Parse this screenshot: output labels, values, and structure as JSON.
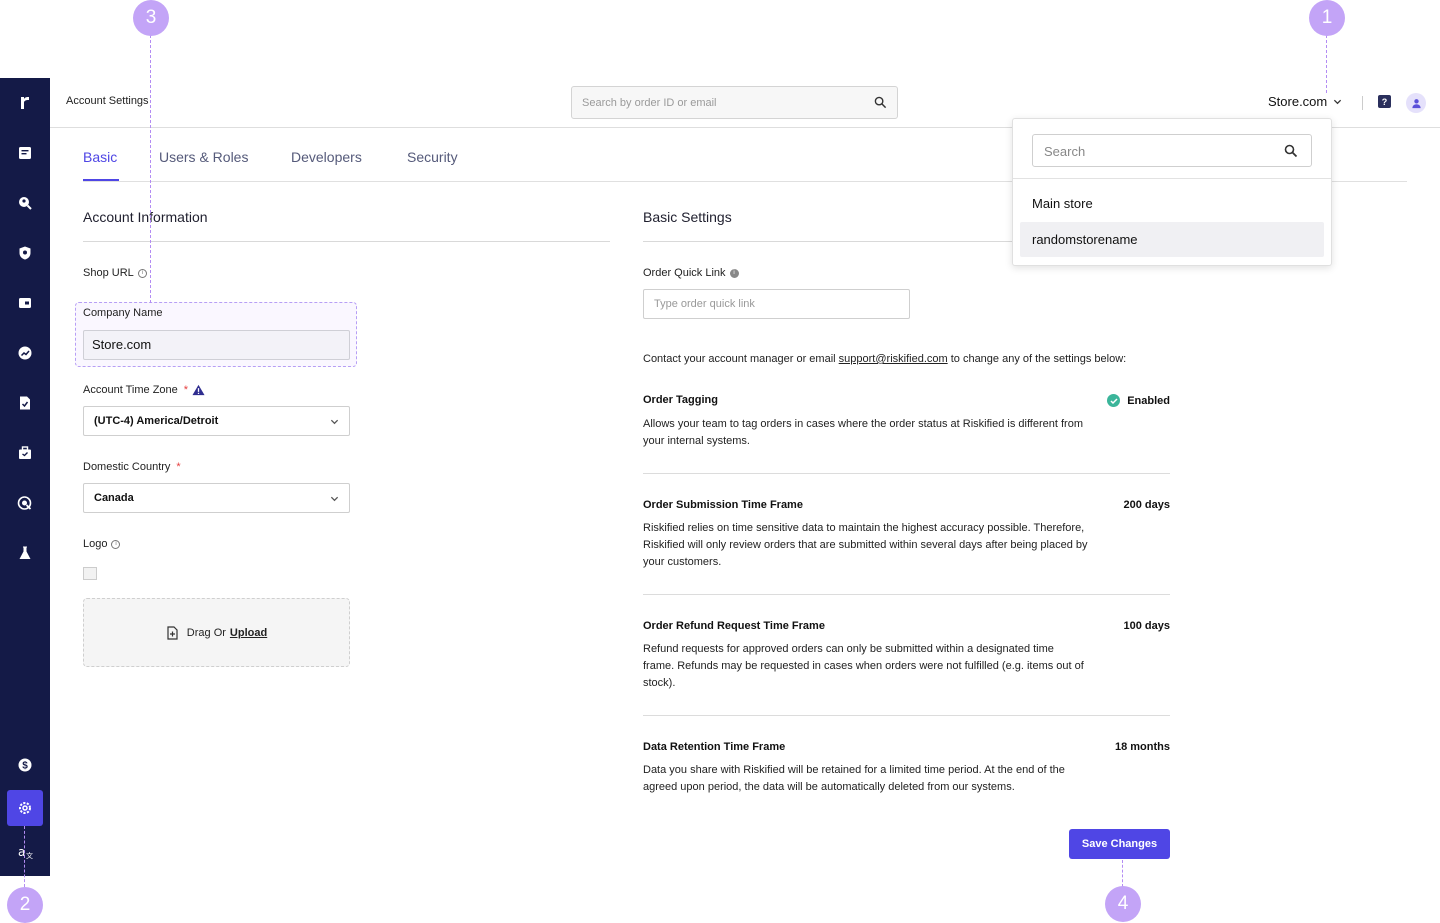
{
  "header": {
    "title": "Account Settings",
    "search_placeholder": "Search by order ID or email",
    "store_selector": "Store.com",
    "help_icon": "?"
  },
  "sidebar": {
    "icons": [
      "logo-icon",
      "orders-icon",
      "investigate-icon",
      "shield-icon",
      "wallet-icon",
      "trend-icon",
      "report-icon",
      "briefcase-icon",
      "radar-icon",
      "flask-icon",
      "dollar-icon",
      "settings-icon",
      "translate-icon"
    ],
    "active": "settings-icon"
  },
  "tabs": [
    {
      "label": "Basic",
      "active": true
    },
    {
      "label": "Users & Roles",
      "active": false
    },
    {
      "label": "Developers",
      "active": false
    },
    {
      "label": "Security",
      "active": false
    }
  ],
  "account_info": {
    "title": "Account Information",
    "shop_url_label": "Shop URL",
    "company_name_label": "Company Name",
    "company_name_value": "Store.com",
    "timezone_label": "Account Time Zone",
    "timezone_required": "*",
    "timezone_value": "(UTC-4) America/Detroit",
    "country_label": "Domestic Country",
    "country_required": "*",
    "country_value": "Canada",
    "logo_label": "Logo",
    "drag_text": "Drag Or",
    "upload_text": "Upload"
  },
  "basic_settings": {
    "title": "Basic Settings",
    "quick_link_label": "Order Quick Link",
    "quick_link_placeholder": "Type order quick link",
    "contact_prefix": "Contact your account manager or email",
    "contact_email": "support@riskified.com",
    "contact_suffix": "to change any of the settings below:",
    "settings": [
      {
        "title": "Order Tagging",
        "value": "Enabled",
        "description": "Allows your team to tag orders in cases where the order status at Riskified is different from your internal systems."
      },
      {
        "title": "Order Submission Time Frame",
        "value": "200 days",
        "description": "Riskified relies on time sensitive data to maintain the highest accuracy possible. Therefore, Riskified will only review orders that are submitted within several days after being placed by your customers."
      },
      {
        "title": "Order Refund Request Time Frame",
        "value": "100 days",
        "description": "Refund requests for approved orders can only be submitted within a designated time frame. Refunds may be requested in cases when orders were not fulfilled (e.g. items out of stock)."
      },
      {
        "title": "Data Retention Time Frame",
        "value": "18 months",
        "description": "Data you share with Riskified will be retained for a limited time period. At the end of the agreed upon period, the data will be automatically deleted from our systems."
      }
    ],
    "save_label": "Save Changes"
  },
  "store_dropdown": {
    "search_placeholder": "Search",
    "items": [
      "Main store",
      "randomstorename"
    ],
    "highlighted": "randomstorename"
  },
  "annotations": [
    "1",
    "2",
    "3",
    "4"
  ],
  "colors": {
    "sidebar": "#141a47",
    "accent": "#4f46e5",
    "annotation": "#c3a4f7",
    "success": "#3bb59a"
  }
}
